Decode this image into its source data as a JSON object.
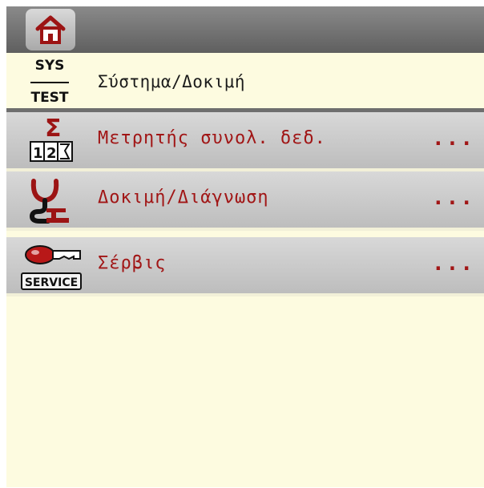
{
  "header": {
    "icon_top": "SYS",
    "icon_bottom": "TEST",
    "title": "Σύστημα/Δοκιμή"
  },
  "menu": {
    "items": [
      {
        "label": "Μετρητής συνολ. δεδ.",
        "more": "...",
        "icon": "sigma-counter-icon",
        "icon_digits": "12"
      },
      {
        "label": "Δοκιμή/Διάγνωση",
        "more": "...",
        "icon": "stethoscope-diagnosis-icon"
      },
      {
        "label": "Σέρβις",
        "more": "...",
        "icon": "service-key-icon",
        "icon_text": "SERVICE"
      }
    ]
  },
  "colors": {
    "background": "#fdfbe0",
    "row_bg": "#cccccc",
    "text_accent": "#a11616",
    "topbar": "#6e6e6e"
  }
}
